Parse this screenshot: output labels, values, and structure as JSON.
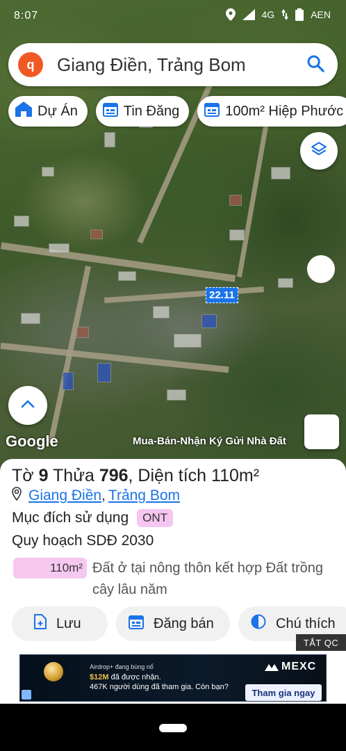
{
  "status_bar": {
    "time": "8:07",
    "network": "4G",
    "battery_label": "AEN"
  },
  "search": {
    "query": "Giang Điền, Trảng Bom",
    "logo_letter": "q"
  },
  "chips": [
    {
      "label": "Dự Án",
      "icon": "home-icon"
    },
    {
      "label": "Tin Đăng",
      "icon": "calendar-icon"
    },
    {
      "label": "100m² Hiệp Phước",
      "icon": "calendar-icon"
    }
  ],
  "map": {
    "marker_label": "22.11",
    "google_label": "Google",
    "credit_text": "Mua-Bán-Nhận Ký Gửi Nhà Đất"
  },
  "parcel": {
    "to_label": "Tờ",
    "to_value": "9",
    "thua_label": "Thửa",
    "thua_value": "796",
    "area_label": ", Diện tích",
    "area_value": "110m²",
    "location_commune": "Giang Điền",
    "location_district": "Trảng Bom",
    "purpose_label": "Mục đích sử dụng",
    "purpose_code": "ONT",
    "plan_label": "Quy hoạch SDĐ 2030",
    "plan_area": "110m²",
    "plan_desc": "Đất ở tại nông thôn kết hợp Đất trồng cây lâu năm"
  },
  "actions": {
    "save": "Lưu",
    "sell": "Đăng bán",
    "legend": "Chú thích"
  },
  "ad": {
    "close_label": "TẮT QC",
    "line1": "Airdrop+ đang bùng nổ",
    "line2_highlight": "$12M",
    "line2_rest": " đã được nhận.",
    "line3": "467K người dùng đã tham gia. Còn bạn?",
    "brand": "MEXC",
    "cta": "Tham gia ngay"
  },
  "colors": {
    "accent": "#1a73e8",
    "chip_pink": "#f5c6ef",
    "brand_orange": "#ef5a24"
  }
}
